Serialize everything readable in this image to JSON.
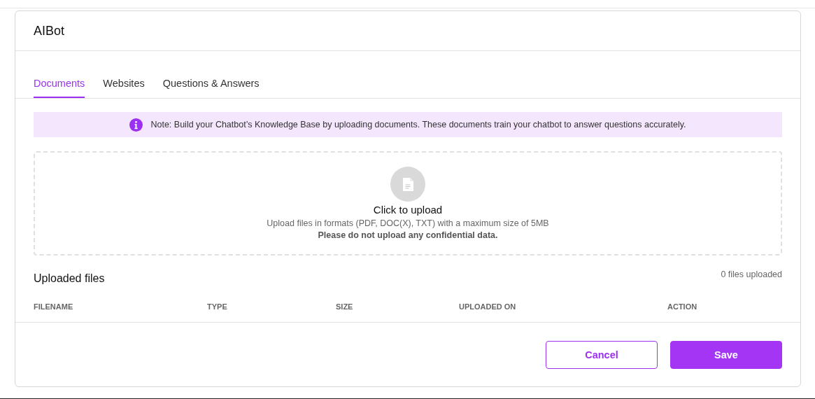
{
  "title": "AIBot",
  "tabs": [
    {
      "label": "Documents",
      "selected": true
    },
    {
      "label": "Websites",
      "selected": false
    },
    {
      "label": "Questions & Answers",
      "selected": false
    }
  ],
  "note": "Note: Build your Chatbot’s Knowledge Base by uploading documents. These documents train your chatbot to answer questions accurately.",
  "upload": {
    "title": "Click to upload",
    "formats": "Upload files in formats (PDF, DOC(X), TXT) with a maximum size of 5MB",
    "warning": "Please do not upload any confidential data."
  },
  "files": {
    "heading": "Uploaded files",
    "count": "0 files uploaded",
    "columns": [
      "FILENAME",
      "TYPE",
      "SIZE",
      "UPLOADED ON",
      "ACTION"
    ]
  },
  "buttons": [
    {
      "label": "Cancel",
      "kind": "secondary"
    },
    {
      "label": "Save",
      "kind": "primary"
    }
  ]
}
